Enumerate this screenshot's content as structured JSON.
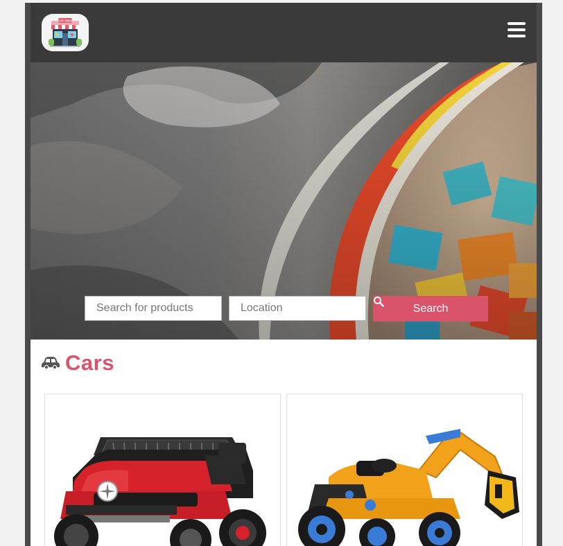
{
  "header": {
    "logo_text": "TOY SHOP",
    "menu_icon": "hamburger-menu-icon"
  },
  "hero": {
    "image": "toy-bucket-photo"
  },
  "search": {
    "products_placeholder": "Search for products",
    "location_placeholder": "Location",
    "button_label": "Search",
    "button_icon": "magnifier-icon",
    "button_color": "#d9536a"
  },
  "category": {
    "title": "Cars",
    "icon": "car-icon",
    "accent_color": "#d9536a"
  },
  "products": [
    {
      "image": "red-electric-jeep-photo"
    },
    {
      "image": "yellow-excavator-ride-on-photo"
    }
  ]
}
